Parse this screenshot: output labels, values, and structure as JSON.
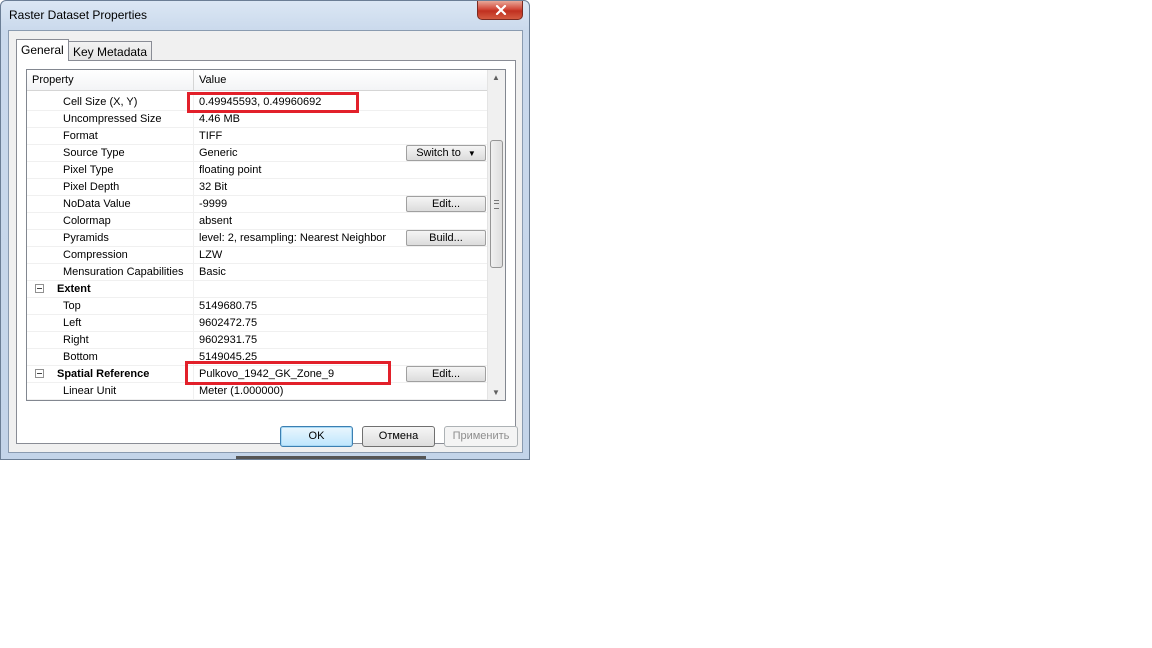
{
  "window": {
    "title": "Raster Dataset Properties"
  },
  "tabs": [
    {
      "label": "General",
      "active": true
    },
    {
      "label": "Key Metadata",
      "active": false
    }
  ],
  "grid": {
    "columns": {
      "property": "Property",
      "value": "Value"
    },
    "rows": [
      {
        "name": "Cell Size (X, Y)",
        "value": "0.49945593, 0.49960692"
      },
      {
        "name": "Uncompressed Size",
        "value": "4.46 MB"
      },
      {
        "name": "Format",
        "value": "TIFF"
      },
      {
        "name": "Source Type",
        "value": "Generic",
        "button": "Switch to"
      },
      {
        "name": "Pixel Type",
        "value": "floating point"
      },
      {
        "name": "Pixel Depth",
        "value": "32 Bit"
      },
      {
        "name": "NoData Value",
        "value": "-9999",
        "button": "Edit..."
      },
      {
        "name": "Colormap",
        "value": "absent"
      },
      {
        "name": "Pyramids",
        "value": "level: 2, resampling: Nearest Neighbor",
        "button": "Build..."
      },
      {
        "name": "Compression",
        "value": "LZW"
      },
      {
        "name": "Mensuration Capabilities",
        "value": "Basic"
      },
      {
        "name": "Extent",
        "value": "",
        "category": true
      },
      {
        "name": "Top",
        "value": "5149680.75"
      },
      {
        "name": "Left",
        "value": "9602472.75"
      },
      {
        "name": "Right",
        "value": "9602931.75"
      },
      {
        "name": "Bottom",
        "value": "5149045.25"
      },
      {
        "name": "Spatial Reference",
        "value": "Pulkovo_1942_GK_Zone_9",
        "category": true,
        "button": "Edit..."
      },
      {
        "name": "Linear Unit",
        "value": "Meter (1.000000)"
      }
    ]
  },
  "buttons": {
    "ok": "OK",
    "cancel": "Отмена",
    "apply": "Применить"
  },
  "colors": {
    "highlight_box": "#e2202a",
    "close_button": "#c9402f"
  }
}
